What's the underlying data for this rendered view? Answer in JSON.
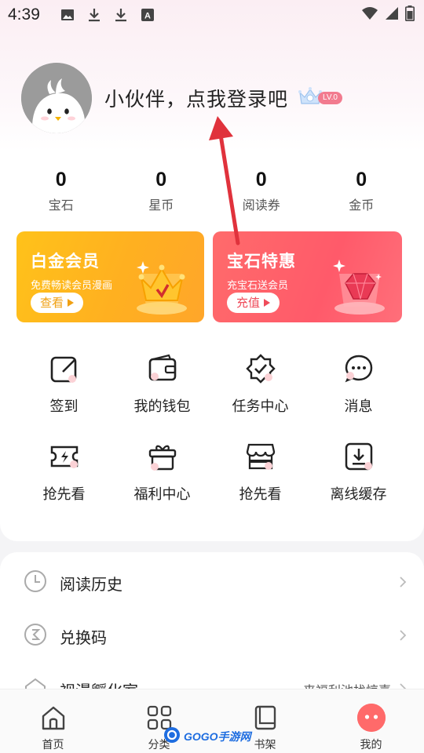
{
  "status_bar": {
    "time": "4:39",
    "icons": [
      "image-icon",
      "download-icon",
      "download-icon",
      "a-icon"
    ],
    "right_icons": [
      "wifi-icon",
      "signal-icon",
      "battery-icon"
    ]
  },
  "profile": {
    "login_prompt": "小伙伴，点我登录吧",
    "level_badge": "LV.0"
  },
  "stats": [
    {
      "value": "0",
      "label": "宝石"
    },
    {
      "value": "0",
      "label": "星币"
    },
    {
      "value": "0",
      "label": "阅读券"
    },
    {
      "value": "0",
      "label": "金币"
    }
  ],
  "promos": {
    "vip": {
      "title": "白金会员",
      "subtitle": "免费畅读会员漫画",
      "button": "查看"
    },
    "gem": {
      "title": "宝石特惠",
      "subtitle": "充宝石送会员",
      "button": "充值"
    }
  },
  "grid": [
    [
      {
        "label": "签到",
        "icon": "edit-icon"
      },
      {
        "label": "我的钱包",
        "icon": "wallet-icon"
      },
      {
        "label": "任务中心",
        "icon": "badge-check-icon"
      },
      {
        "label": "消息",
        "icon": "chat-bubble-icon"
      }
    ],
    [
      {
        "label": "抢先看",
        "icon": "ticket-bolt-icon"
      },
      {
        "label": "福利中心",
        "icon": "gift-icon"
      },
      {
        "label": "抢先看",
        "icon": "store-icon"
      },
      {
        "label": "离线缓存",
        "icon": "download-box-icon"
      }
    ]
  ],
  "list": [
    {
      "label": "阅读历史",
      "icon": "clock-icon",
      "extra": ""
    },
    {
      "label": "兑换码",
      "icon": "coupon-icon",
      "extra": ""
    },
    {
      "label": "视漫孵化室",
      "icon": "incubator-icon",
      "extra": "来福利池找惊喜"
    }
  ],
  "tabbar": [
    {
      "label": "首页",
      "icon": "home-icon"
    },
    {
      "label": "分类",
      "icon": "grid-icon"
    },
    {
      "label": "书架",
      "icon": "bookshelf-icon"
    },
    {
      "label": "我的",
      "icon": "profile-dots-icon"
    }
  ],
  "watermark": "GOGO手游网",
  "colors": {
    "accent": "#ff5a6a",
    "gold": "#ffb020",
    "annotation_arrow": "#e0323c"
  }
}
